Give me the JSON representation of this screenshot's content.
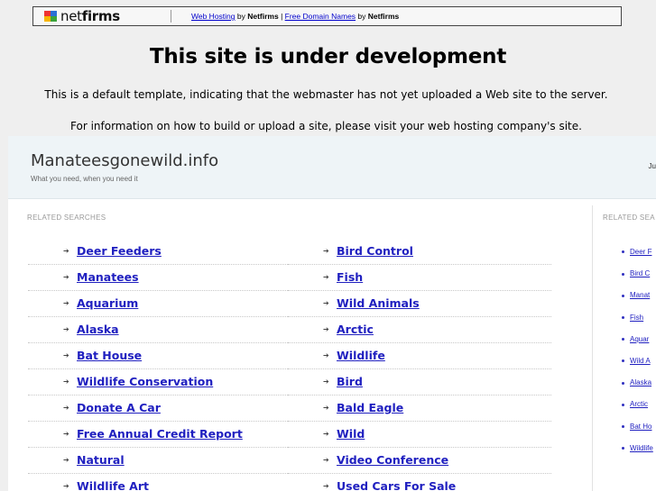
{
  "topbar": {
    "logo_prefix": "net",
    "logo_suffix": "firms",
    "link1": "Web Hosting",
    "by1": " by ",
    "brand1": "Netfirms",
    "sep": " | ",
    "link2": "Free Domain Names",
    "by2": " by ",
    "brand2": "Netfirms"
  },
  "heading": "This site is under development",
  "info_line_1": "This is a default template, indicating that the webmaster has not yet uploaded a Web site to the server.",
  "info_line_2": "For information on how to build or upload a site, please visit your web hosting company's site.",
  "parked": {
    "site_title": "Manateesgonewild.info",
    "tagline": "What you need, when you need it",
    "header_right": "Ju",
    "related_label": "RELATED SEARCHES",
    "related_label_right": "RELATED SEA",
    "left_links": [
      "Deer Feeders",
      "Manatees",
      "Aquarium",
      "Alaska",
      "Bat House",
      "Wildlife Conservation",
      "Donate A Car",
      "Free Annual Credit Report",
      "Natural",
      "Wildlife Art"
    ],
    "right_links": [
      "Bird Control",
      "Fish",
      "Wild Animals",
      "Arctic",
      "Wildlife",
      "Bird",
      "Bald Eagle",
      "Wild",
      "Video Conference",
      "Used Cars For Sale"
    ],
    "side_links": [
      "Deer F",
      "Bird C",
      "Manat",
      "Fish",
      "Aquar",
      "Wild A",
      "Alaska",
      "Arctic",
      "Bat Ho",
      "Wildlife"
    ]
  },
  "colors": {
    "link": "#2020c0",
    "header_bg": "#eef4f7",
    "page_bg": "#efefef"
  }
}
